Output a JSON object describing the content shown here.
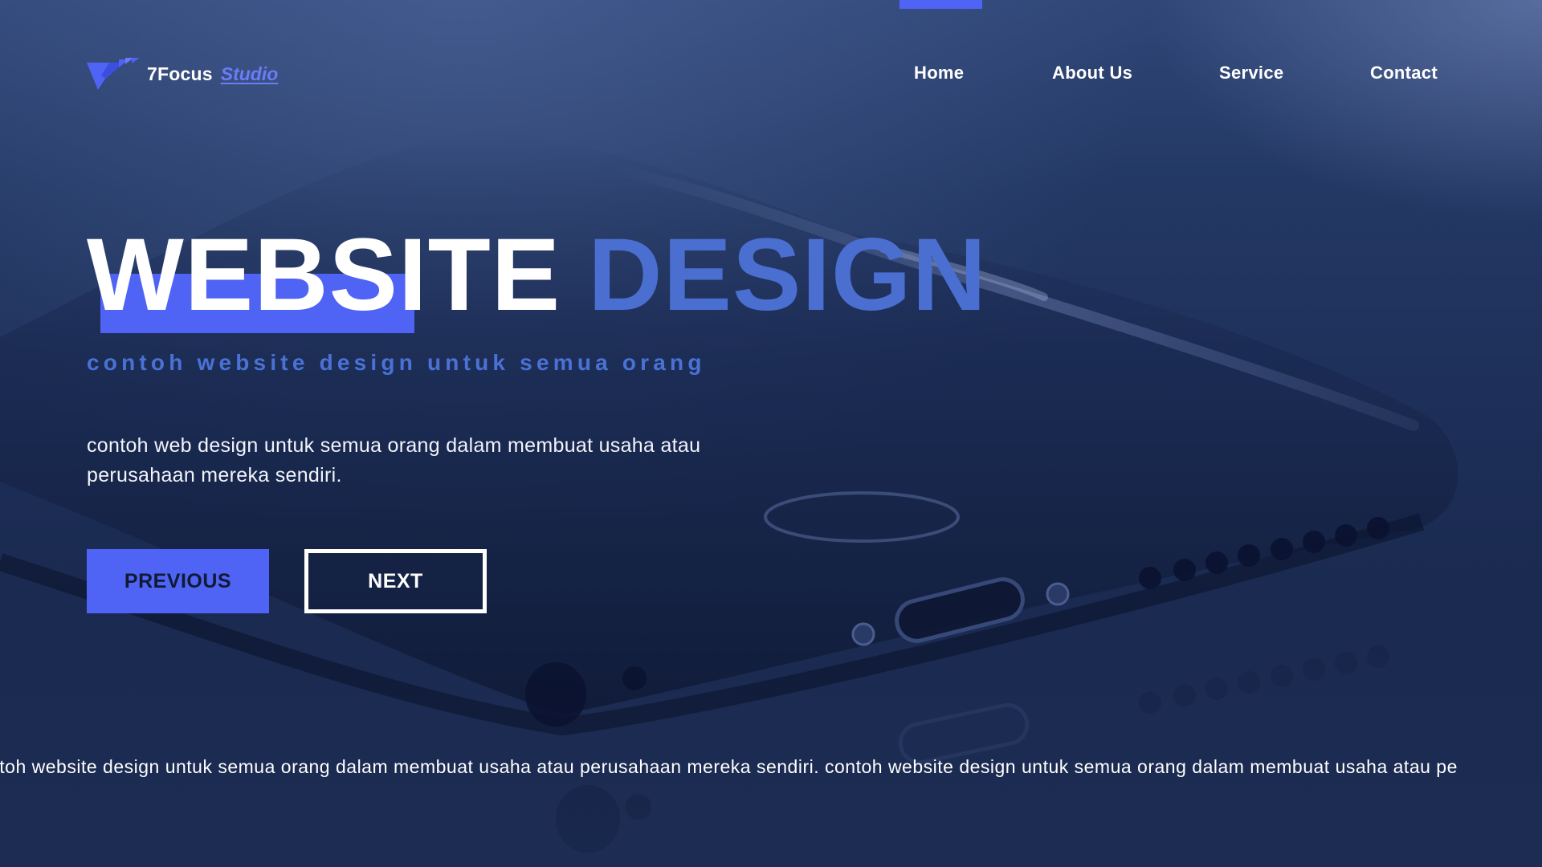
{
  "header": {
    "brand_name": "7Focus",
    "brand_suffix": "Studio",
    "logo_icon": "chevron-arrow-logo-icon",
    "nav": [
      {
        "label": "Home",
        "active": true
      },
      {
        "label": "About Us",
        "active": false
      },
      {
        "label": "Service",
        "active": false
      },
      {
        "label": "Contact",
        "active": false
      }
    ]
  },
  "hero": {
    "title_primary": "WEBSITE",
    "title_secondary": "DESIGN",
    "subtitle": "contoh website design untuk semua orang",
    "description": "contoh web design untuk semua orang dalam membuat usaha atau perusahaan mereka sendiri.",
    "prev_label": "PREVIOUS",
    "next_label": "NEXT"
  },
  "ticker": {
    "text": "ntoh website design untuk semua orang dalam membuat usaha atau perusahaan mereka sendiri. contoh website design untuk semua orang dalam membuat usaha atau pe"
  },
  "colors": {
    "accent": "#4f63f5",
    "title_secondary": "#4a6fd0",
    "background": "#1c2d55",
    "text": "#ffffff"
  }
}
